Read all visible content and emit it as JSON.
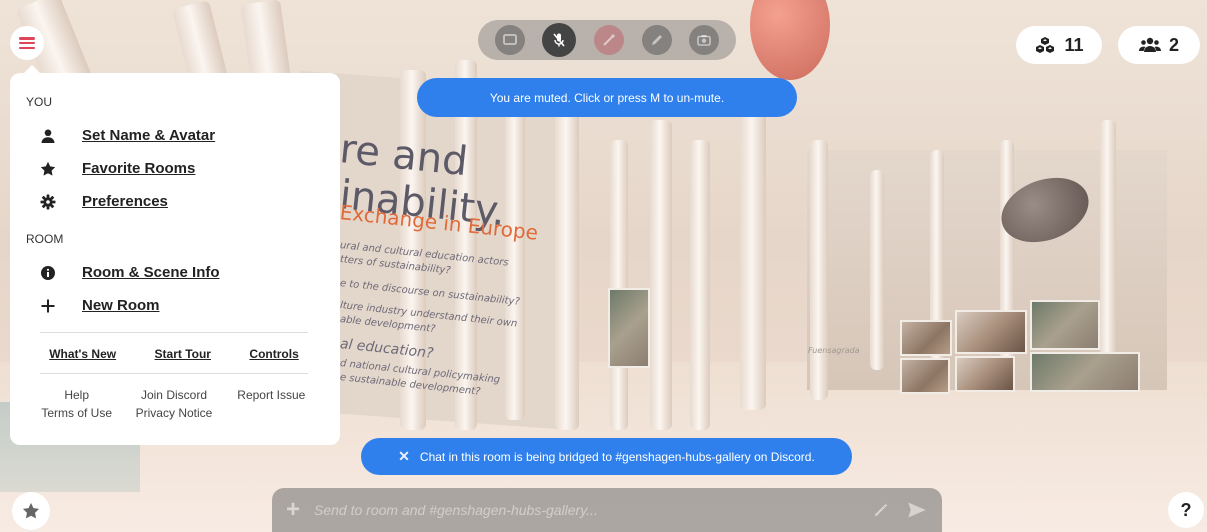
{
  "colors": {
    "accent": "#e0445a",
    "toast_blue": "#2f80ed",
    "panel_bg": "#ffffff"
  },
  "scene": {
    "wall_text": {
      "line1": "re and",
      "line2": "inability.",
      "line3": "Exchange in Europe",
      "line4": "ural and cultural education actors",
      "line5": "tters of sustainability?",
      "line6": "e to the discourse on sustainability?",
      "line7": "lture industry understand their own",
      "line8": "able development?",
      "line9": "al education?",
      "line10": "d national cultural policymaking",
      "line11": "e sustainable development?"
    },
    "signature": "Fuensagrada"
  },
  "toolbar": {
    "tools": [
      {
        "icon": "screen-share-icon",
        "state": "inactive"
      },
      {
        "icon": "microphone-muted-icon",
        "state": "active"
      },
      {
        "icon": "magic-wand-icon",
        "state": "inactive"
      },
      {
        "icon": "pen-icon",
        "state": "inactive"
      },
      {
        "icon": "camera-icon",
        "state": "inactive"
      }
    ],
    "muted_tooltip": "You are muted. Click or press M to un-mute."
  },
  "counters": {
    "objects": "11",
    "people": "2"
  },
  "menu": {
    "you_label": "YOU",
    "you_items": [
      {
        "icon": "person-icon",
        "label": "Set Name & Avatar"
      },
      {
        "icon": "star-icon",
        "label": "Favorite Rooms"
      },
      {
        "icon": "gear-icon",
        "label": "Preferences"
      }
    ],
    "room_label": "ROOM",
    "room_items": [
      {
        "icon": "info-icon",
        "label": "Room & Scene Info"
      },
      {
        "icon": "plus-icon",
        "label": "New Room"
      }
    ],
    "bold_links": [
      "What's New",
      "Start Tour",
      "Controls"
    ],
    "footer_links": [
      "Help",
      "Join Discord",
      "Report Issue",
      "Terms of Use",
      "Privacy Notice"
    ]
  },
  "bridge_toast": {
    "close_glyph": "✕",
    "text": "Chat in this room is being bridged to #genshagen-hubs-gallery on Discord."
  },
  "chat": {
    "plus_glyph": "+",
    "placeholder": "Send to room and #genshagen-hubs-gallery..."
  },
  "help_glyph": "?"
}
